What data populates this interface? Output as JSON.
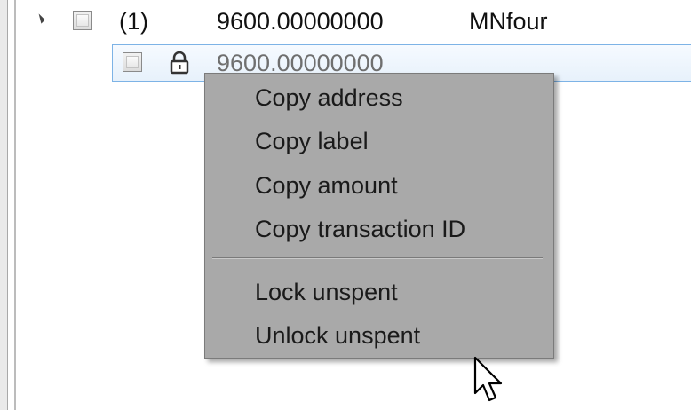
{
  "tree": {
    "parent_row": {
      "count": "(1)",
      "amount": "9600.00000000",
      "label": "MNfour"
    },
    "child_row": {
      "amount": "9600.00000000"
    }
  },
  "context_menu": {
    "items": [
      {
        "label": "Copy address"
      },
      {
        "label": "Copy label"
      },
      {
        "label": "Copy amount"
      },
      {
        "label": "Copy transaction ID"
      }
    ],
    "lock_items": [
      {
        "label": "Lock unspent"
      },
      {
        "label": "Unlock unspent"
      }
    ]
  },
  "icons": [
    "expander-triangle-icon",
    "checkbox-icon",
    "lock-icon",
    "mouse-cursor-icon"
  ]
}
